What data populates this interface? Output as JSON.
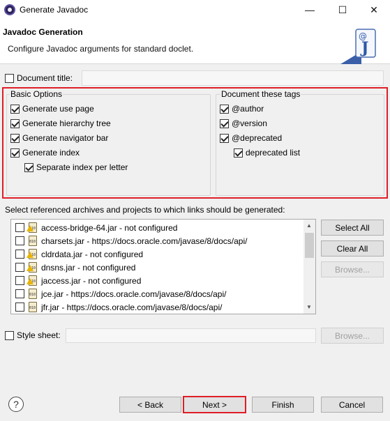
{
  "window": {
    "title": "Generate Javadoc",
    "minimize": "—",
    "maximize": "☐",
    "close": "✕"
  },
  "header": {
    "title": "Javadoc Generation",
    "description": "Configure Javadoc arguments for standard doclet."
  },
  "document_title": {
    "label": "Document title:",
    "checked": false,
    "value": ""
  },
  "basic_options": {
    "label": "Basic Options",
    "items": [
      {
        "label": "Generate use page",
        "checked": true
      },
      {
        "label": "Generate hierarchy tree",
        "checked": true
      },
      {
        "label": "Generate navigator bar",
        "checked": true
      },
      {
        "label": "Generate index",
        "checked": true
      },
      {
        "label": "Separate index per letter",
        "checked": true
      }
    ]
  },
  "tags": {
    "label": "Document these tags",
    "items": [
      {
        "label": "@author",
        "checked": true
      },
      {
        "label": "@version",
        "checked": true
      },
      {
        "label": "@deprecated",
        "checked": true
      },
      {
        "label": "deprecated list",
        "checked": true
      }
    ]
  },
  "references": {
    "label": "Select referenced archives and projects to which links should be generated:",
    "items": [
      {
        "label": "access-bridge-64.jar - not configured",
        "warning": true
      },
      {
        "label": "charsets.jar - https://docs.oracle.com/javase/8/docs/api/",
        "warning": false
      },
      {
        "label": "cldrdata.jar - not configured",
        "warning": true
      },
      {
        "label": "dnsns.jar - not configured",
        "warning": true
      },
      {
        "label": "jaccess.jar - not configured",
        "warning": true
      },
      {
        "label": "jce.jar - https://docs.oracle.com/javase/8/docs/api/",
        "warning": false
      },
      {
        "label": "jfr.jar - https://docs.oracle.com/javase/8/docs/api/",
        "warning": false
      }
    ],
    "select_all": "Select All",
    "clear_all": "Clear All",
    "browse": "Browse..."
  },
  "style_sheet": {
    "label": "Style sheet:",
    "checked": false,
    "value": "",
    "browse": "Browse..."
  },
  "footer": {
    "help": "?",
    "back": "< Back",
    "next": "Next >",
    "finish": "Finish",
    "cancel": "Cancel"
  }
}
